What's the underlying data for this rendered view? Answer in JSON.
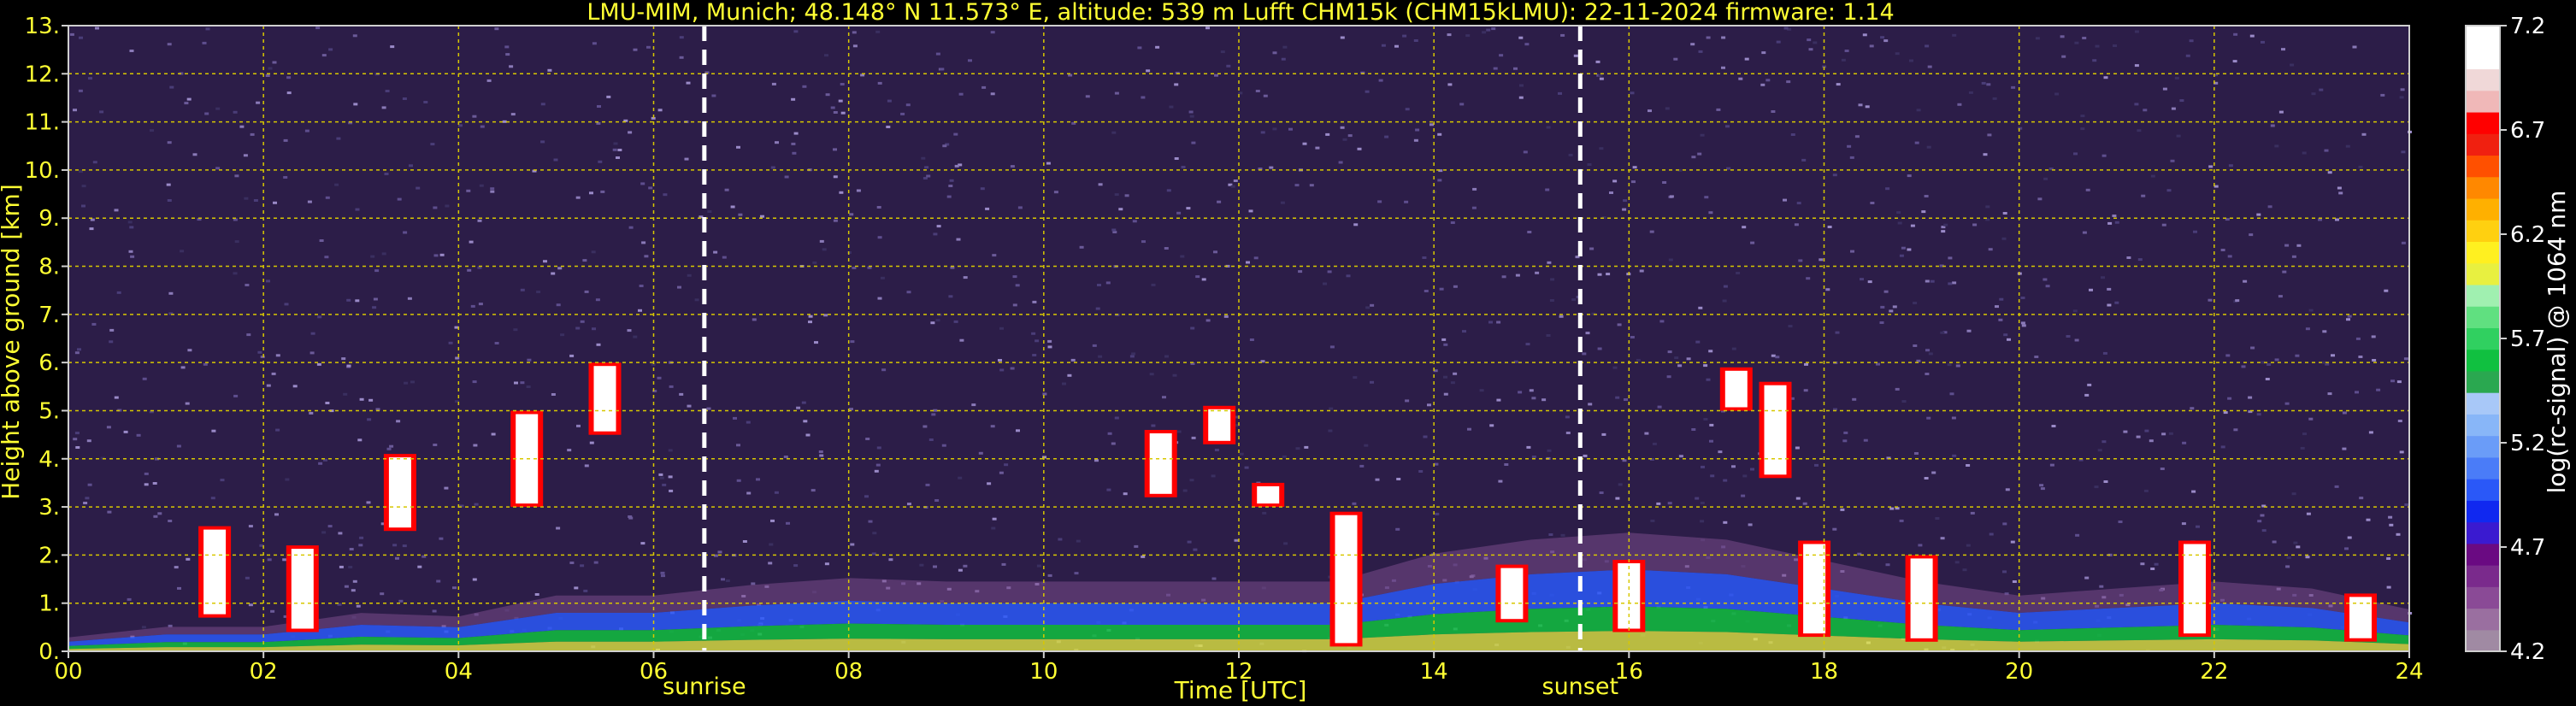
{
  "chart_data": {
    "type": "heatmap",
    "title": "LMU-MIM, Munich; 48.148° N 11.573° E, altitude: 539 m    Lufft CHM15k (CHM15kLMU): 22-11-2024    firmware: 1.14",
    "xlabel": "Time [UTC]",
    "ylabel": "Height above ground [km]",
    "xlim": [
      0,
      24
    ],
    "ylim": [
      0,
      13
    ],
    "x_ticks": [
      "00",
      "02",
      "04",
      "06",
      "08",
      "10",
      "12",
      "14",
      "16",
      "18",
      "20",
      "22",
      "24"
    ],
    "y_ticks": [
      "0.",
      "1.",
      "2.",
      "3.",
      "4.",
      "5.",
      "6.",
      "7.",
      "8.",
      "9.",
      "10.",
      "11.",
      "12.",
      "13."
    ],
    "grid": true,
    "colorbar": {
      "label": "log(rc-signal) @ 1064 nm",
      "range": [
        4.2,
        7.2
      ],
      "ticks": [
        "4.2",
        "4.7",
        "5.2",
        "5.7",
        "6.2",
        "6.7",
        "7.2"
      ],
      "colors": [
        "#a08aa3",
        "#9a6fa0",
        "#8a4a96",
        "#7a2a8c",
        "#6a0a82",
        "#3a1ad0",
        "#1028f0",
        "#2a58f8",
        "#4a7cf8",
        "#6a9cf8",
        "#88b6f8",
        "#a8c8f8",
        "#2aa850",
        "#10c040",
        "#30d060",
        "#60e080",
        "#a0f0b0",
        "#e8f040",
        "#fff020",
        "#ffd010",
        "#ffb000",
        "#ff8800",
        "#ff5000",
        "#f02010",
        "#ff0000",
        "#f0b8b8",
        "#f0d8d8",
        "#ffffff",
        "#ffffff"
      ]
    },
    "annotations": [
      {
        "label": "sunrise",
        "x": 6.52
      },
      {
        "label": "sunset",
        "x": 15.5
      }
    ],
    "boundary_layer": [
      {
        "x": 0.0,
        "y": 0.2
      },
      {
        "x": 1.0,
        "y": 0.35
      },
      {
        "x": 2.0,
        "y": 0.35
      },
      {
        "x": 3.0,
        "y": 0.55
      },
      {
        "x": 4.0,
        "y": 0.5
      },
      {
        "x": 5.0,
        "y": 0.8
      },
      {
        "x": 6.0,
        "y": 0.8
      },
      {
        "x": 7.0,
        "y": 0.95
      },
      {
        "x": 8.0,
        "y": 1.05
      },
      {
        "x": 9.0,
        "y": 1.0
      },
      {
        "x": 10.0,
        "y": 1.0
      },
      {
        "x": 11.0,
        "y": 1.0
      },
      {
        "x": 12.0,
        "y": 1.0
      },
      {
        "x": 13.0,
        "y": 1.0
      },
      {
        "x": 14.0,
        "y": 1.4
      },
      {
        "x": 15.0,
        "y": 1.6
      },
      {
        "x": 16.0,
        "y": 1.7
      },
      {
        "x": 17.0,
        "y": 1.6
      },
      {
        "x": 18.0,
        "y": 1.3
      },
      {
        "x": 19.0,
        "y": 1.0
      },
      {
        "x": 20.0,
        "y": 0.8
      },
      {
        "x": 21.0,
        "y": 0.9
      },
      {
        "x": 22.0,
        "y": 1.0
      },
      {
        "x": 23.0,
        "y": 0.9
      },
      {
        "x": 24.0,
        "y": 0.6
      }
    ],
    "cloud_features": [
      {
        "x": 1.5,
        "y_bottom": 0.7,
        "y_top": 2.6
      },
      {
        "x": 2.4,
        "y_bottom": 0.4,
        "y_top": 2.2
      },
      {
        "x": 3.4,
        "y_bottom": 2.5,
        "y_top": 4.1
      },
      {
        "x": 4.7,
        "y_bottom": 3.0,
        "y_top": 5.0
      },
      {
        "x": 5.5,
        "y_bottom": 4.5,
        "y_top": 6.0
      },
      {
        "x": 11.2,
        "y_bottom": 3.2,
        "y_top": 4.6
      },
      {
        "x": 11.8,
        "y_bottom": 4.3,
        "y_top": 5.1
      },
      {
        "x": 12.3,
        "y_bottom": 3.0,
        "y_top": 3.5
      },
      {
        "x": 13.1,
        "y_bottom": 0.1,
        "y_top": 2.9
      },
      {
        "x": 14.8,
        "y_bottom": 0.6,
        "y_top": 1.8
      },
      {
        "x": 16.0,
        "y_bottom": 0.4,
        "y_top": 1.9
      },
      {
        "x": 17.1,
        "y_bottom": 5.0,
        "y_top": 5.9
      },
      {
        "x": 17.5,
        "y_bottom": 3.6,
        "y_top": 5.6
      },
      {
        "x": 17.9,
        "y_bottom": 0.3,
        "y_top": 2.3
      },
      {
        "x": 19.0,
        "y_bottom": 0.2,
        "y_top": 2.0
      },
      {
        "x": 21.8,
        "y_bottom": 0.3,
        "y_top": 2.3
      },
      {
        "x": 23.5,
        "y_bottom": 0.2,
        "y_top": 1.2
      }
    ]
  }
}
